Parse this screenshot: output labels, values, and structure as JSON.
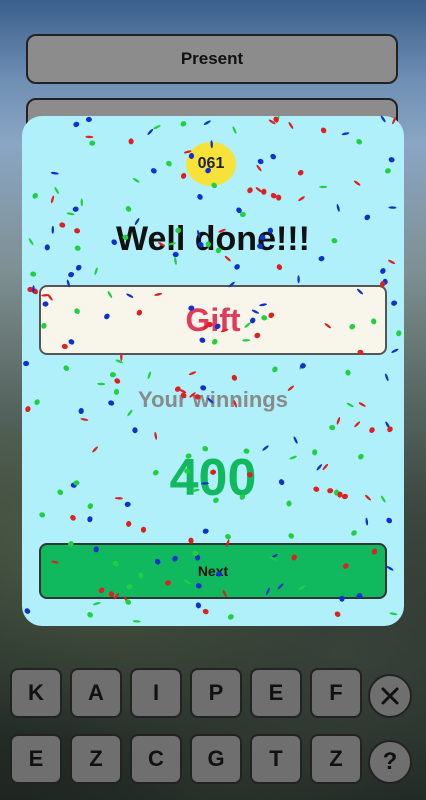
{
  "answer_options": [
    "Present",
    ""
  ],
  "dialog": {
    "level": "061",
    "title": "Well done!!!",
    "answer": "Gift",
    "winnings_label": "Your winnings",
    "winnings_value": "400",
    "next_label": "Next"
  },
  "keyboard": {
    "row1": [
      "K",
      "A",
      "I",
      "P",
      "E",
      "F"
    ],
    "row2": [
      "E",
      "Z",
      "C",
      "G",
      "T",
      "Z"
    ],
    "help_label": "?"
  },
  "colors": {
    "modal_bg": "#aff0fa",
    "answer_text": "#e23a5a",
    "accent_green": "#10b85e",
    "level_badge": "#f7e23a",
    "confetti": [
      "#1030d0",
      "#e02020",
      "#20d040"
    ]
  }
}
